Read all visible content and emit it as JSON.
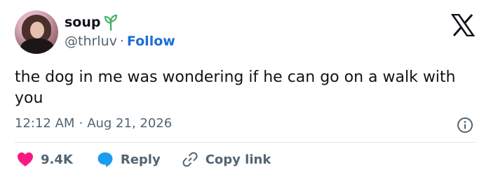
{
  "author": {
    "display_name": "soup",
    "handle": "@thrluv",
    "separator": "·",
    "follow_label": "Follow",
    "avatar_icon": "profile-photo",
    "badge_icon": "sprout-icon"
  },
  "brand": {
    "logo_icon": "x-logo"
  },
  "tweet": {
    "text": "the dog in me was wondering if he can go on a walk with you",
    "time": "12:12 AM",
    "separator": "·",
    "date": "Aug 21, 2026"
  },
  "actions": {
    "likes_count": "9.4K",
    "reply_label": "Reply",
    "copy_link_label": "Copy link"
  },
  "colors": {
    "text": "#0f1419",
    "muted": "#536471",
    "link": "#1d6fd0",
    "like": "#f91880",
    "reply": "#1d9bf0",
    "sprout": "#3fae5a"
  }
}
